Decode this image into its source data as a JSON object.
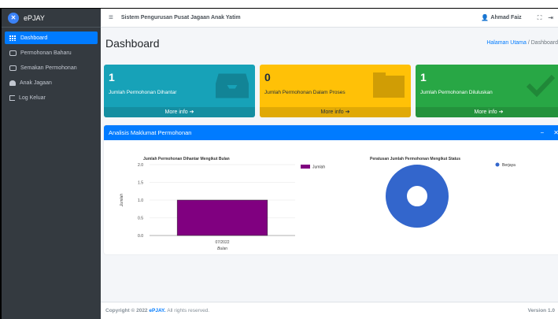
{
  "brand": {
    "name": "ePJAY"
  },
  "sidebar": {
    "items": [
      {
        "label": "Dashboard",
        "icon": "dashboard-grid-icon",
        "active": true
      },
      {
        "label": "Permohonan Baharu",
        "icon": "hdd-icon"
      },
      {
        "label": "Semakan Permohonan",
        "icon": "hdd-icon"
      },
      {
        "label": "Anak Jagaan",
        "icon": "user-icon"
      },
      {
        "label": "Log Keluar",
        "icon": "sign-out-icon"
      }
    ]
  },
  "topbar": {
    "title": "Sistem Pengurusan Pusat Jagaan Anak Yatim",
    "user_name": "Ahmad Faiz"
  },
  "header": {
    "title": "Dashboard",
    "breadcrumb_home": "Halaman Utama",
    "breadcrumb_sep": "/",
    "breadcrumb_current": "Dashboard"
  },
  "stats": [
    {
      "value": "1",
      "label": "Jumlah Permohonan Dihantar",
      "more": "More info",
      "color": "#17a2b8"
    },
    {
      "value": "0",
      "label": "Jumlah Permohonan Dalam Proses",
      "more": "More info",
      "color": "#ffc107"
    },
    {
      "value": "1",
      "label": "Jumlah Permohonan Diluluskan",
      "more": "More info",
      "color": "#28a745"
    }
  ],
  "card": {
    "title": "Analisis Maklumat Permohonan"
  },
  "chart_data": [
    {
      "type": "bar",
      "title": "Jumlah Permohonan Dihantar Mengikut Bulan",
      "categories": [
        "07/2022"
      ],
      "series": [
        {
          "name": "Jumlah",
          "values": [
            1
          ],
          "color": "#800080"
        }
      ],
      "xlabel": "Bulan",
      "ylabel": "Jumlah",
      "ylim": [
        0,
        2
      ],
      "yticks": [
        "0.0",
        "0.5",
        "1.0",
        "1.5",
        "2.0"
      ],
      "legend": "right"
    },
    {
      "type": "pie",
      "title": "Peratusan Jumlah Permohonan Mengikut Status",
      "labels": [
        "Berjaya"
      ],
      "values": [
        1
      ],
      "colors": [
        "#3366cc"
      ],
      "legend": "right"
    }
  ],
  "footer": {
    "prefix": "Copyright © 2022",
    "brand": "ePJAY.",
    "suffix": "All rights reserved.",
    "version": "Version 1.0"
  },
  "colors": {
    "primary": "#007bff",
    "sidebar": "#343a40"
  }
}
